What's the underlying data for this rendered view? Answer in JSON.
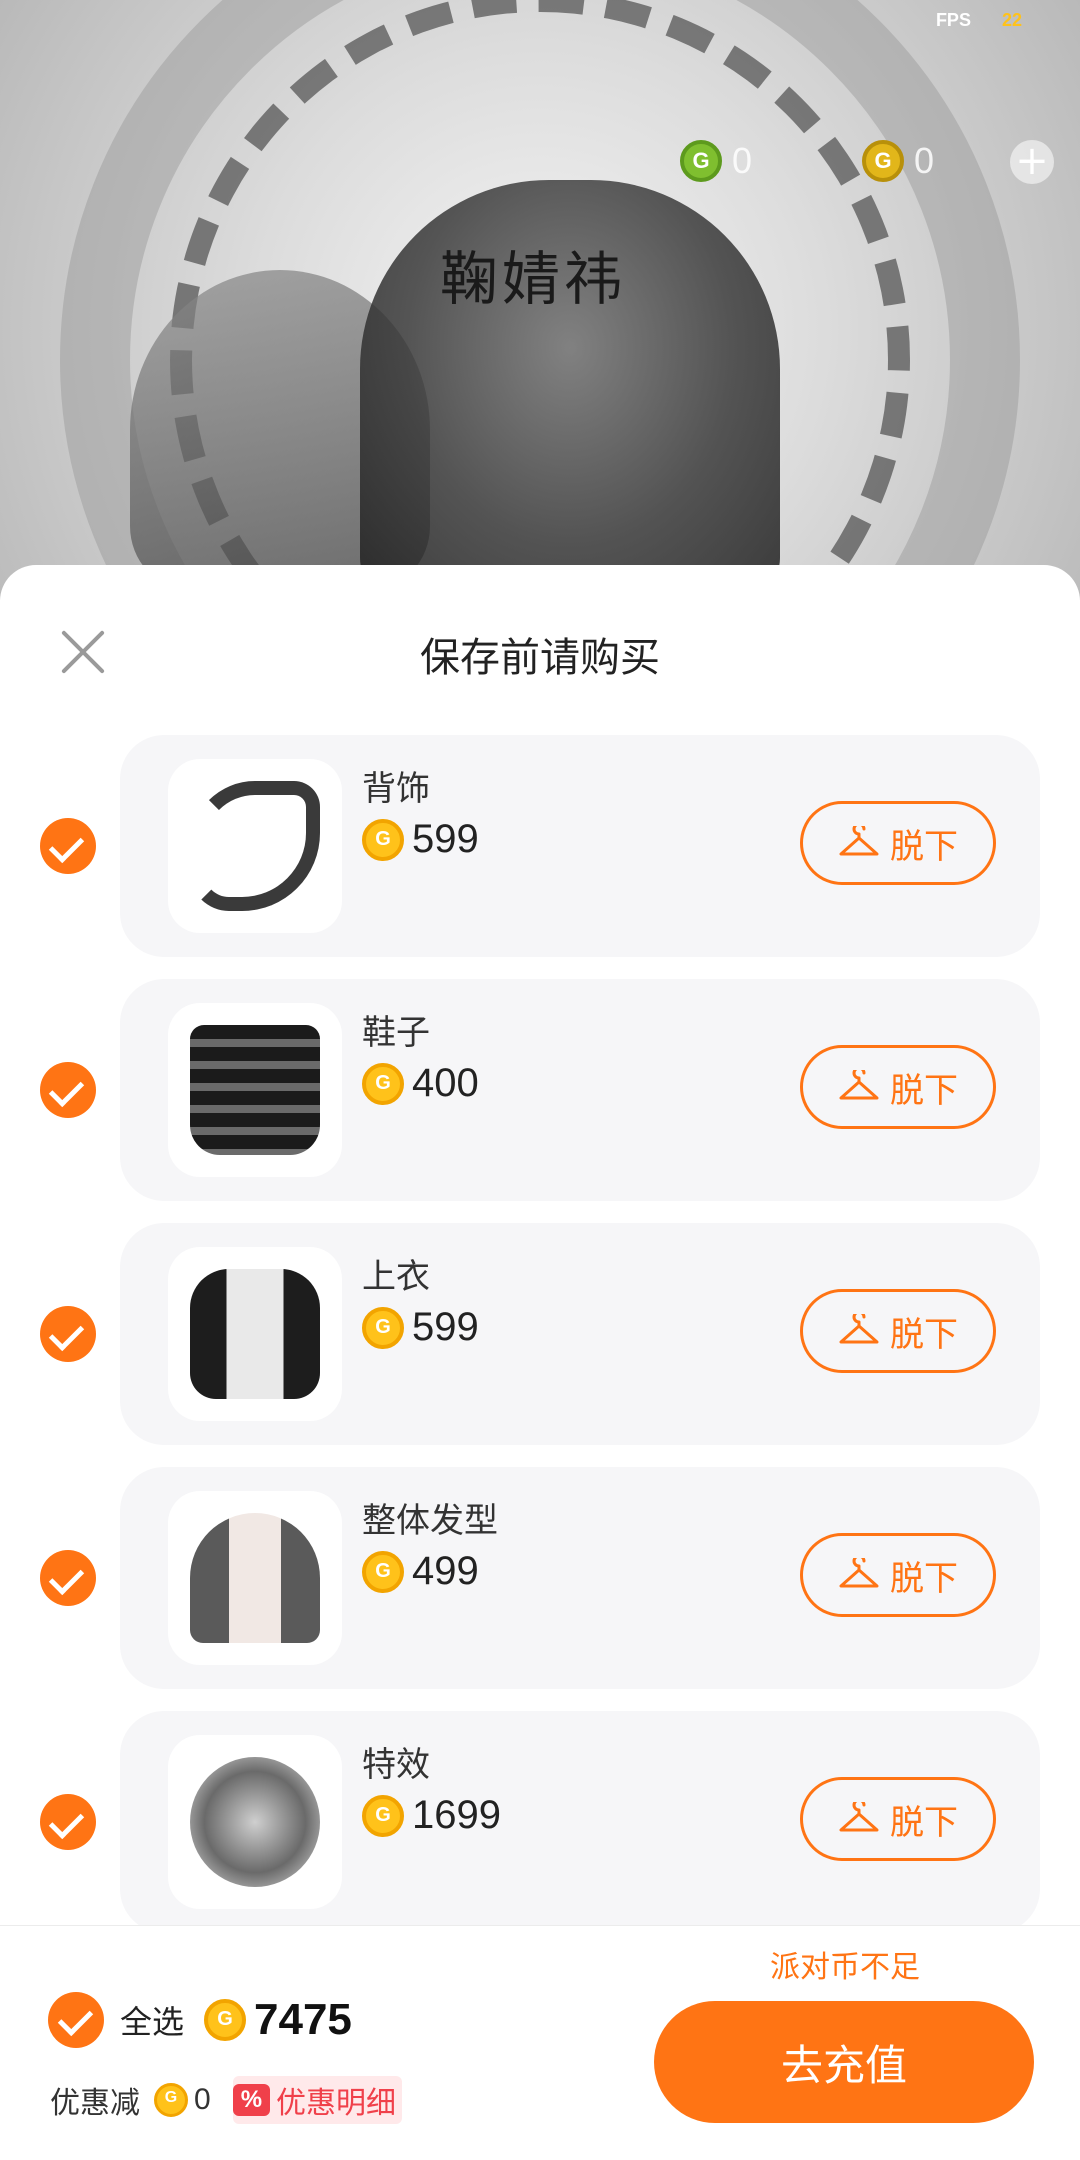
{
  "status": {
    "fps_label": "FPS",
    "fps_value": "22"
  },
  "wallet": {
    "green_balance": "0",
    "gold_balance": "0"
  },
  "scene": {
    "calligraphy": "鞠婧祎"
  },
  "sheet": {
    "title": "保存前请购买",
    "items": [
      {
        "name": "背饰",
        "price": "599",
        "action": "脱下",
        "icon": "dragon-back-accessory"
      },
      {
        "name": "鞋子",
        "price": "400",
        "action": "脱下",
        "icon": "boots"
      },
      {
        "name": "上衣",
        "price": "599",
        "action": "脱下",
        "icon": "jacket"
      },
      {
        "name": "整体发型",
        "price": "499",
        "action": "脱下",
        "icon": "hairstyle"
      },
      {
        "name": "特效",
        "price": "1699",
        "action": "脱下",
        "icon": "dragon-effect"
      }
    ]
  },
  "footer": {
    "insufficient": "派对币不足",
    "select_all": "全选",
    "total": "7475",
    "discount_label": "优惠减",
    "discount_amount": "0",
    "discount_badge": "%",
    "discount_detail": "优惠明细",
    "recharge": "去充值"
  },
  "colors": {
    "accent": "#ff7414",
    "coin": "#ffc21a",
    "discount": "#f0404a"
  }
}
